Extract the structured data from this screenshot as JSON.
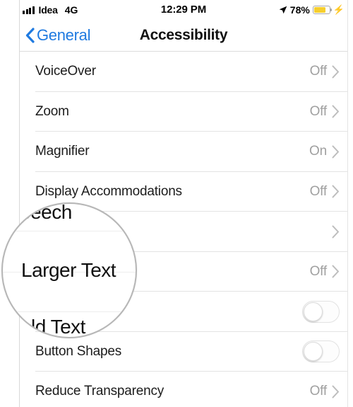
{
  "status_bar": {
    "signal_icon": "signal-bars-icon",
    "signal_bars_filled": 4,
    "carrier": "Idea",
    "network": "4G",
    "time": "12:29 PM",
    "location_icon": "location-arrow-icon",
    "battery_percent": "78%",
    "battery_level": 78,
    "battery_color": "#f7cf2e",
    "battery_icon": "battery-icon",
    "charging_icon": "lightning-bolt-icon"
  },
  "nav_bar": {
    "back_icon": "chevron-left-icon",
    "back_label": "General",
    "title": "Accessibility",
    "accent_color": "#1f7ae0"
  },
  "list": {
    "rows": [
      {
        "label": "VoiceOver",
        "value": "Off",
        "accessory": "chevron"
      },
      {
        "label": "Zoom",
        "value": "Off",
        "accessory": "chevron"
      },
      {
        "label": "Magnifier",
        "value": "On",
        "accessory": "chevron"
      },
      {
        "label": "Display Accommodations",
        "value": "Off",
        "accessory": "chevron"
      },
      {
        "label": "Speech",
        "value": "",
        "accessory": "chevron"
      },
      {
        "label": "Larger Text",
        "value": "Off",
        "accessory": "chevron"
      },
      {
        "label": "Bold Text",
        "value": "",
        "accessory": "switch",
        "switch_on": false
      },
      {
        "label": "Button Shapes",
        "value": "",
        "accessory": "switch",
        "switch_on": false
      },
      {
        "label": "Reduce Transparency",
        "value": "Off",
        "accessory": "chevron"
      }
    ]
  },
  "magnifier": {
    "name": "magnifier-lens",
    "border_color": "#b6b6b6",
    "magnified_lines": [
      {
        "text": "peech",
        "full_text": "Speech"
      },
      {
        "text": "Larger Text",
        "full_text": "Larger Text"
      },
      {
        "text": "ld Text",
        "full_text": "Bold Text"
      }
    ]
  }
}
